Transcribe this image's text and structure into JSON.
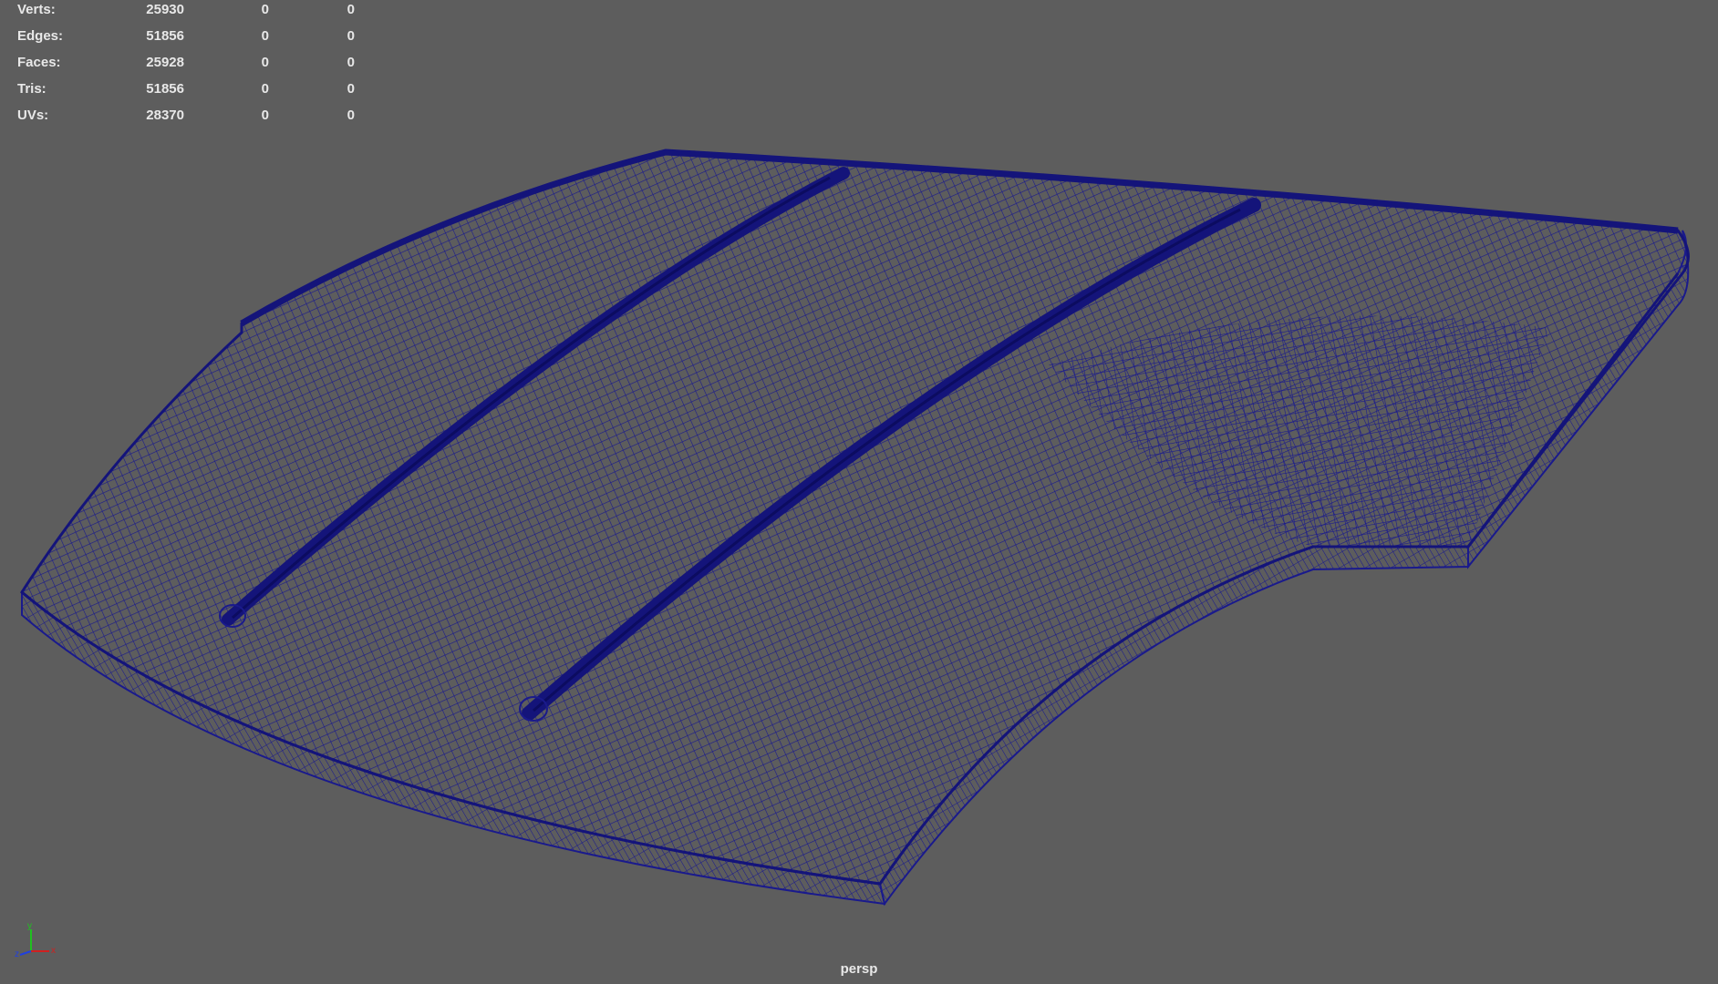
{
  "hud": {
    "rows": [
      {
        "label": "Verts:",
        "v1": "25930",
        "v2": "0",
        "v3": "0"
      },
      {
        "label": "Edges:",
        "v1": "51856",
        "v2": "0",
        "v3": "0"
      },
      {
        "label": "Faces:",
        "v1": "25928",
        "v2": "0",
        "v3": "0"
      },
      {
        "label": "Tris:",
        "v1": "51856",
        "v2": "0",
        "v3": "0"
      },
      {
        "label": "UVs:",
        "v1": "28370",
        "v2": "0",
        "v3": "0"
      }
    ]
  },
  "camera": {
    "name": "persp"
  },
  "axis": {
    "x": "x",
    "y": "y",
    "z": "z"
  },
  "colors": {
    "background": "#5d5d5d",
    "wireframe": "#1a1a8c",
    "hud_text": "#e8e8e8",
    "axis_x": "#d02020",
    "axis_y": "#20c020",
    "axis_z": "#2040e0"
  },
  "model": {
    "type": "hood",
    "wireframe": "wireframe-mesh"
  }
}
